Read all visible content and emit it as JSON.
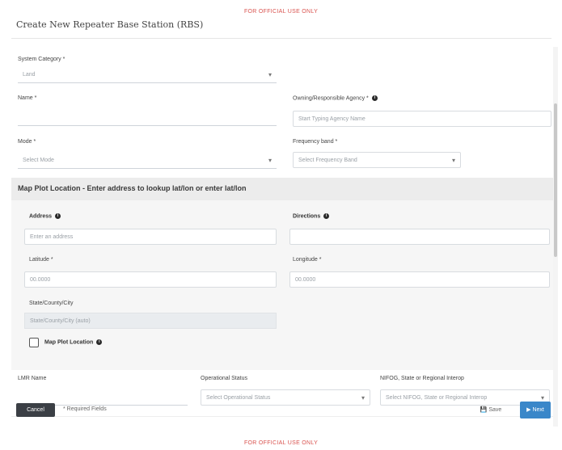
{
  "banner": {
    "top": "FOR OFFICIAL USE ONLY",
    "bottom": "FOR OFFICIAL USE ONLY"
  },
  "page_title": "Create New Repeater Base Station (RBS)",
  "form": {
    "system_category": {
      "label": "System Category *",
      "value": "Land"
    },
    "name": {
      "label": "Name *",
      "value": ""
    },
    "owning_agency": {
      "label": "Owning/Responsible Agency *",
      "placeholder": "Start Typing Agency Name"
    },
    "mode": {
      "label": "Mode *",
      "value": "Select Mode"
    },
    "frequency_band": {
      "label": "Frequency band *",
      "value": "Select Frequency Band"
    },
    "map_section_title": "Map Plot Location - Enter address to lookup lat/lon or enter lat/lon",
    "address": {
      "label": "Address",
      "placeholder": "Enter an address"
    },
    "directions": {
      "label": "Directions",
      "value": ""
    },
    "latitude": {
      "label": "Latitude *",
      "value": "00.0000"
    },
    "longitude": {
      "label": "Longitude *",
      "value": "00.0000"
    },
    "state_county": {
      "label": "State/County/City",
      "value": "State/County/City (auto)"
    },
    "map_plot_location": {
      "label": "Map Plot Location"
    },
    "lmr_name": {
      "label": "LMR Name",
      "value": ""
    },
    "operational_status": {
      "label": "Operational Status",
      "value": "Select Operational Status"
    },
    "nifog": {
      "label": "NIFOG, State or Regional Interop",
      "value": "Select NIFOG, State or Regional Interop"
    }
  },
  "footer": {
    "cancel_label": "Cancel",
    "required_text": "* Required Fields",
    "save_label": "Save",
    "next_label": "Next"
  }
}
